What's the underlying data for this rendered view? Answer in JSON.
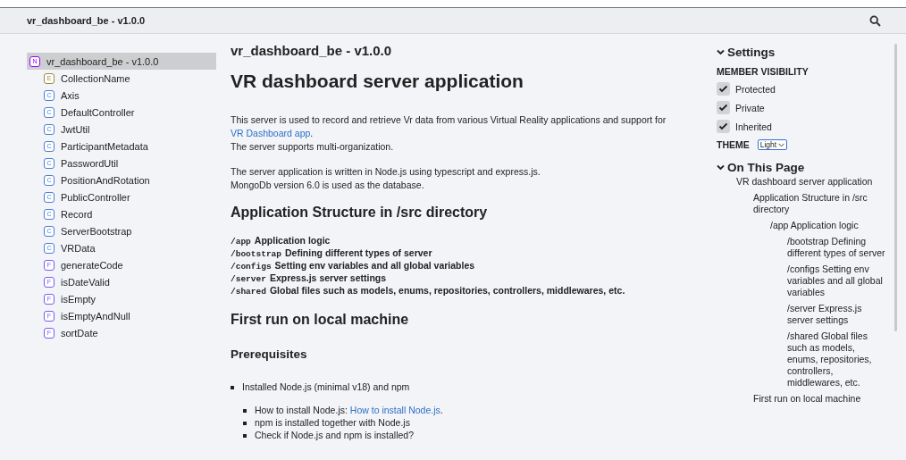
{
  "header": {
    "title": "vr_dashboard_be - v1.0.0"
  },
  "nav": {
    "root": {
      "icon": "N",
      "kind": "namespace",
      "label": "vr_dashboard_be - v1.0.0",
      "selected": true
    },
    "items": [
      {
        "icon": "E",
        "kind": "enum",
        "label": "CollectionName",
        "selected": false
      },
      {
        "icon": "C",
        "kind": "class",
        "label": "Axis",
        "selected": false
      },
      {
        "icon": "C",
        "kind": "class",
        "label": "DefaultController",
        "selected": false
      },
      {
        "icon": "C",
        "kind": "class",
        "label": "JwtUtil",
        "selected": false
      },
      {
        "icon": "C",
        "kind": "class",
        "label": "ParticipantMetadata",
        "selected": false
      },
      {
        "icon": "C",
        "kind": "class",
        "label": "PasswordUtil",
        "selected": false
      },
      {
        "icon": "C",
        "kind": "class",
        "label": "PositionAndRotation",
        "selected": false
      },
      {
        "icon": "C",
        "kind": "class",
        "label": "PublicController",
        "selected": false
      },
      {
        "icon": "C",
        "kind": "class",
        "label": "Record",
        "selected": false
      },
      {
        "icon": "C",
        "kind": "class",
        "label": "ServerBootstrap",
        "selected": false
      },
      {
        "icon": "C",
        "kind": "class",
        "label": "VRData",
        "selected": false
      },
      {
        "icon": "F",
        "kind": "function",
        "label": "generateCode",
        "selected": false
      },
      {
        "icon": "F",
        "kind": "function",
        "label": "isDateValid",
        "selected": false
      },
      {
        "icon": "F",
        "kind": "function",
        "label": "isEmpty",
        "selected": false
      },
      {
        "icon": "F",
        "kind": "function",
        "label": "isEmptyAndNull",
        "selected": false
      },
      {
        "icon": "F",
        "kind": "function",
        "label": "sortDate",
        "selected": false
      }
    ]
  },
  "main": {
    "page_title": "vr_dashboard_be - v1.0.0",
    "heading": "VR dashboard server application",
    "intro": {
      "before": "This server is used to record and retrieve Vr data from various Virtual Reality applications and support for ",
      "link": "VR Dashboard app",
      "after": ".",
      "line2": "The server supports multi-organization."
    },
    "para2": [
      "The server application is written in Node.js using typescript and express.js.",
      "MongoDb version 6.0 is used as the database."
    ],
    "structure_heading": "Application Structure in /src directory",
    "structure": [
      {
        "code": "/app",
        "text": "Application logic"
      },
      {
        "code": "/bootstrap",
        "text": "Defining different types of server"
      },
      {
        "code": "/configs",
        "text": "Setting env variables and all global variables"
      },
      {
        "code": "/server",
        "text": "Express.js server settings"
      },
      {
        "code": "/shared",
        "text": "Global files such as models, enums, repositories, controllers, middlewares, etc."
      }
    ],
    "first_run_heading": "First run on local machine",
    "prereq_heading": "Prerequisites",
    "prerequisites": [
      {
        "text": "Installed Node.js (minimal v18) and npm",
        "children": [
          {
            "text": "How to install Node.js: ",
            "link": "How to install Node.js",
            "after": "."
          },
          {
            "text": "npm is installed together with Node.js"
          },
          {
            "text": "Check if Node.js and npm is installed?"
          }
        ]
      }
    ]
  },
  "settings": {
    "title": "Settings",
    "expanded": true,
    "visibility_label": "MEMBER VISIBILITY",
    "options": [
      {
        "label": "Protected",
        "checked": true
      },
      {
        "label": "Private",
        "checked": true
      },
      {
        "label": "Inherited",
        "checked": true
      }
    ],
    "theme_label": "THEME",
    "theme_value": "Light"
  },
  "on_this_page": {
    "title": "On This Page",
    "expanded": true,
    "items": [
      {
        "label": "VR dashboard server application",
        "children": [
          {
            "label": "Application Structure in /src directory",
            "children": [
              {
                "label": "/app Application logic",
                "children": [
                  {
                    "label": "/bootstrap Defining different types of server"
                  },
                  {
                    "label": "/configs Setting env variables and all global variables"
                  },
                  {
                    "label": "/server Express.js server settings"
                  },
                  {
                    "label": "/shared Global files such as models, enums, repositories, controllers, middlewares, etc."
                  }
                ]
              }
            ]
          },
          {
            "label": "First run on local machine"
          }
        ]
      }
    ]
  }
}
